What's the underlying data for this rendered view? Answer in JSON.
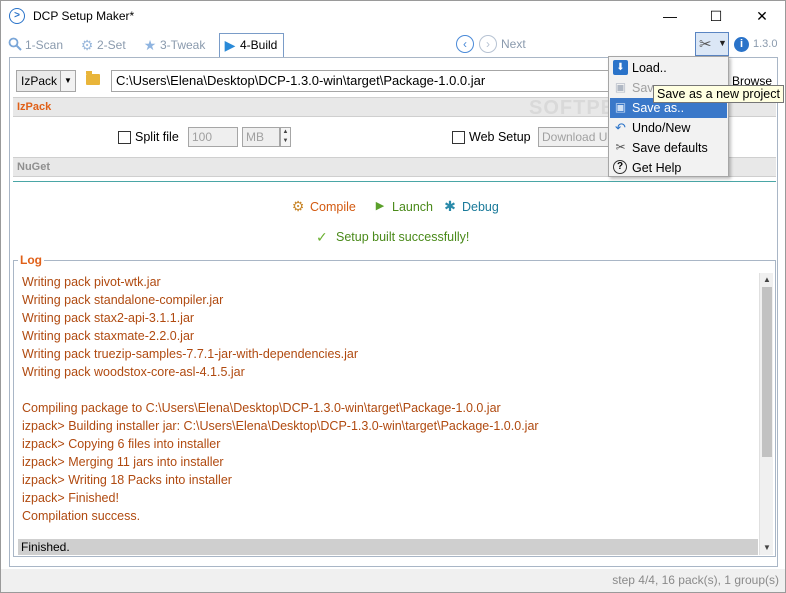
{
  "window": {
    "title": "DCP Setup Maker*",
    "minimize": "—",
    "maximize": "☐",
    "close": "✕"
  },
  "steps": [
    {
      "label": "1-Scan",
      "icon": "magnifier-icon"
    },
    {
      "label": "2-Set",
      "icon": "gear-icon"
    },
    {
      "label": "3-Tweak",
      "icon": "star-icon"
    },
    {
      "label": "4-Build",
      "icon": "play-icon"
    }
  ],
  "nav": {
    "next_label": "Next",
    "version": "1.3.0"
  },
  "build": {
    "packager": "IzPack",
    "path": "C:\\Users\\Elena\\Desktop\\DCP-1.3.0-win\\target\\Package-1.0.0.jar",
    "browse_label": "Browse"
  },
  "izpack": {
    "header": "IzPack",
    "split_file_label": "Split file",
    "split_size": "100",
    "split_unit": "MB",
    "web_setup_label": "Web Setup",
    "web_setup_placeholder": "Download URL"
  },
  "nuget": {
    "header": "NuGet"
  },
  "actions": {
    "compile": "Compile",
    "launch": "Launch",
    "debug": "Debug"
  },
  "result": "Setup built successfully!",
  "log": {
    "title": "Log",
    "lines": [
      "Writing pack pivot-wtk.jar",
      "Writing pack standalone-compiler.jar",
      "Writing pack stax2-api-3.1.1.jar",
      "Writing pack staxmate-2.2.0.jar",
      "Writing pack truezip-samples-7.7.1-jar-with-dependencies.jar",
      "Writing pack woodstox-core-asl-4.1.5.jar",
      "",
      "Compiling package to C:\\Users\\Elena\\Desktop\\DCP-1.3.0-win\\target\\Package-1.0.0.jar",
      "izpack> Building installer jar: C:\\Users\\Elena\\Desktop\\DCP-1.3.0-win\\target\\Package-1.0.0.jar",
      "izpack> Copying 6 files into installer",
      "izpack> Merging 11 jars into installer",
      "izpack> Writing 18 Packs into installer",
      "izpack> Finished!",
      "Compilation success."
    ],
    "status": "Finished."
  },
  "statusbar": "step 4/4, 16 pack(s), 1 group(s)",
  "menu": {
    "items": [
      {
        "label": "Load..",
        "icon": "download-icon",
        "state": "normal"
      },
      {
        "label": "Save",
        "icon": "save-icon",
        "state": "disabled"
      },
      {
        "label": "Save as..",
        "icon": "save-as-icon",
        "state": "highlighted"
      },
      {
        "label": "Undo/New",
        "icon": "undo-icon",
        "state": "normal"
      },
      {
        "label": "Save defaults",
        "icon": "tools-icon",
        "state": "normal"
      },
      {
        "label": "Get Help",
        "icon": "help-icon",
        "state": "normal"
      }
    ],
    "tooltip": "Save as a new project"
  },
  "watermark": "SOFTPEDIA",
  "colors": {
    "accent_orange": "#e06018",
    "log_text": "#b04a10",
    "success_green": "#4a8a1a",
    "menu_highlight": "#3a78c9",
    "link_blue": "#2a73c9"
  }
}
